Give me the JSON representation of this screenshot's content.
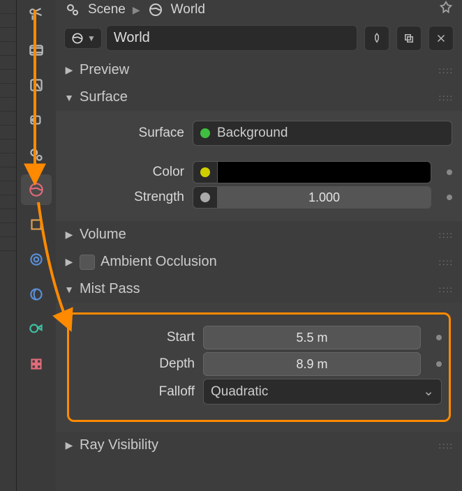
{
  "breadcrumb": {
    "scene": "Scene",
    "world": "World"
  },
  "datablock": {
    "name": "World"
  },
  "sections": {
    "preview": "Preview",
    "surface": "Surface",
    "volume": "Volume",
    "ao": "Ambient Occlusion",
    "mist": "Mist Pass",
    "ray": "Ray Visibility"
  },
  "surface": {
    "label_surface": "Surface",
    "value_surface": "Background",
    "swatch_surface": "#3fbf3f",
    "label_color": "Color",
    "swatch_color": "#cfcf00",
    "color_value": "#000000",
    "label_strength": "Strength",
    "strength_value": "1.000",
    "swatch_strength": "#aaaaaa"
  },
  "mist": {
    "label_start": "Start",
    "start_value": "5.5 m",
    "label_depth": "Depth",
    "depth_value": "8.9 m",
    "label_falloff": "Falloff",
    "falloff_value": "Quadratic"
  },
  "icon_tabs": [
    "render-tab",
    "output-tab",
    "view-layer-tab",
    "scene-tab",
    "world-tab",
    "object-tab",
    "modifiers-tab",
    "particles-tab",
    "physics-tab",
    "constraints-tab",
    "material-tab"
  ]
}
